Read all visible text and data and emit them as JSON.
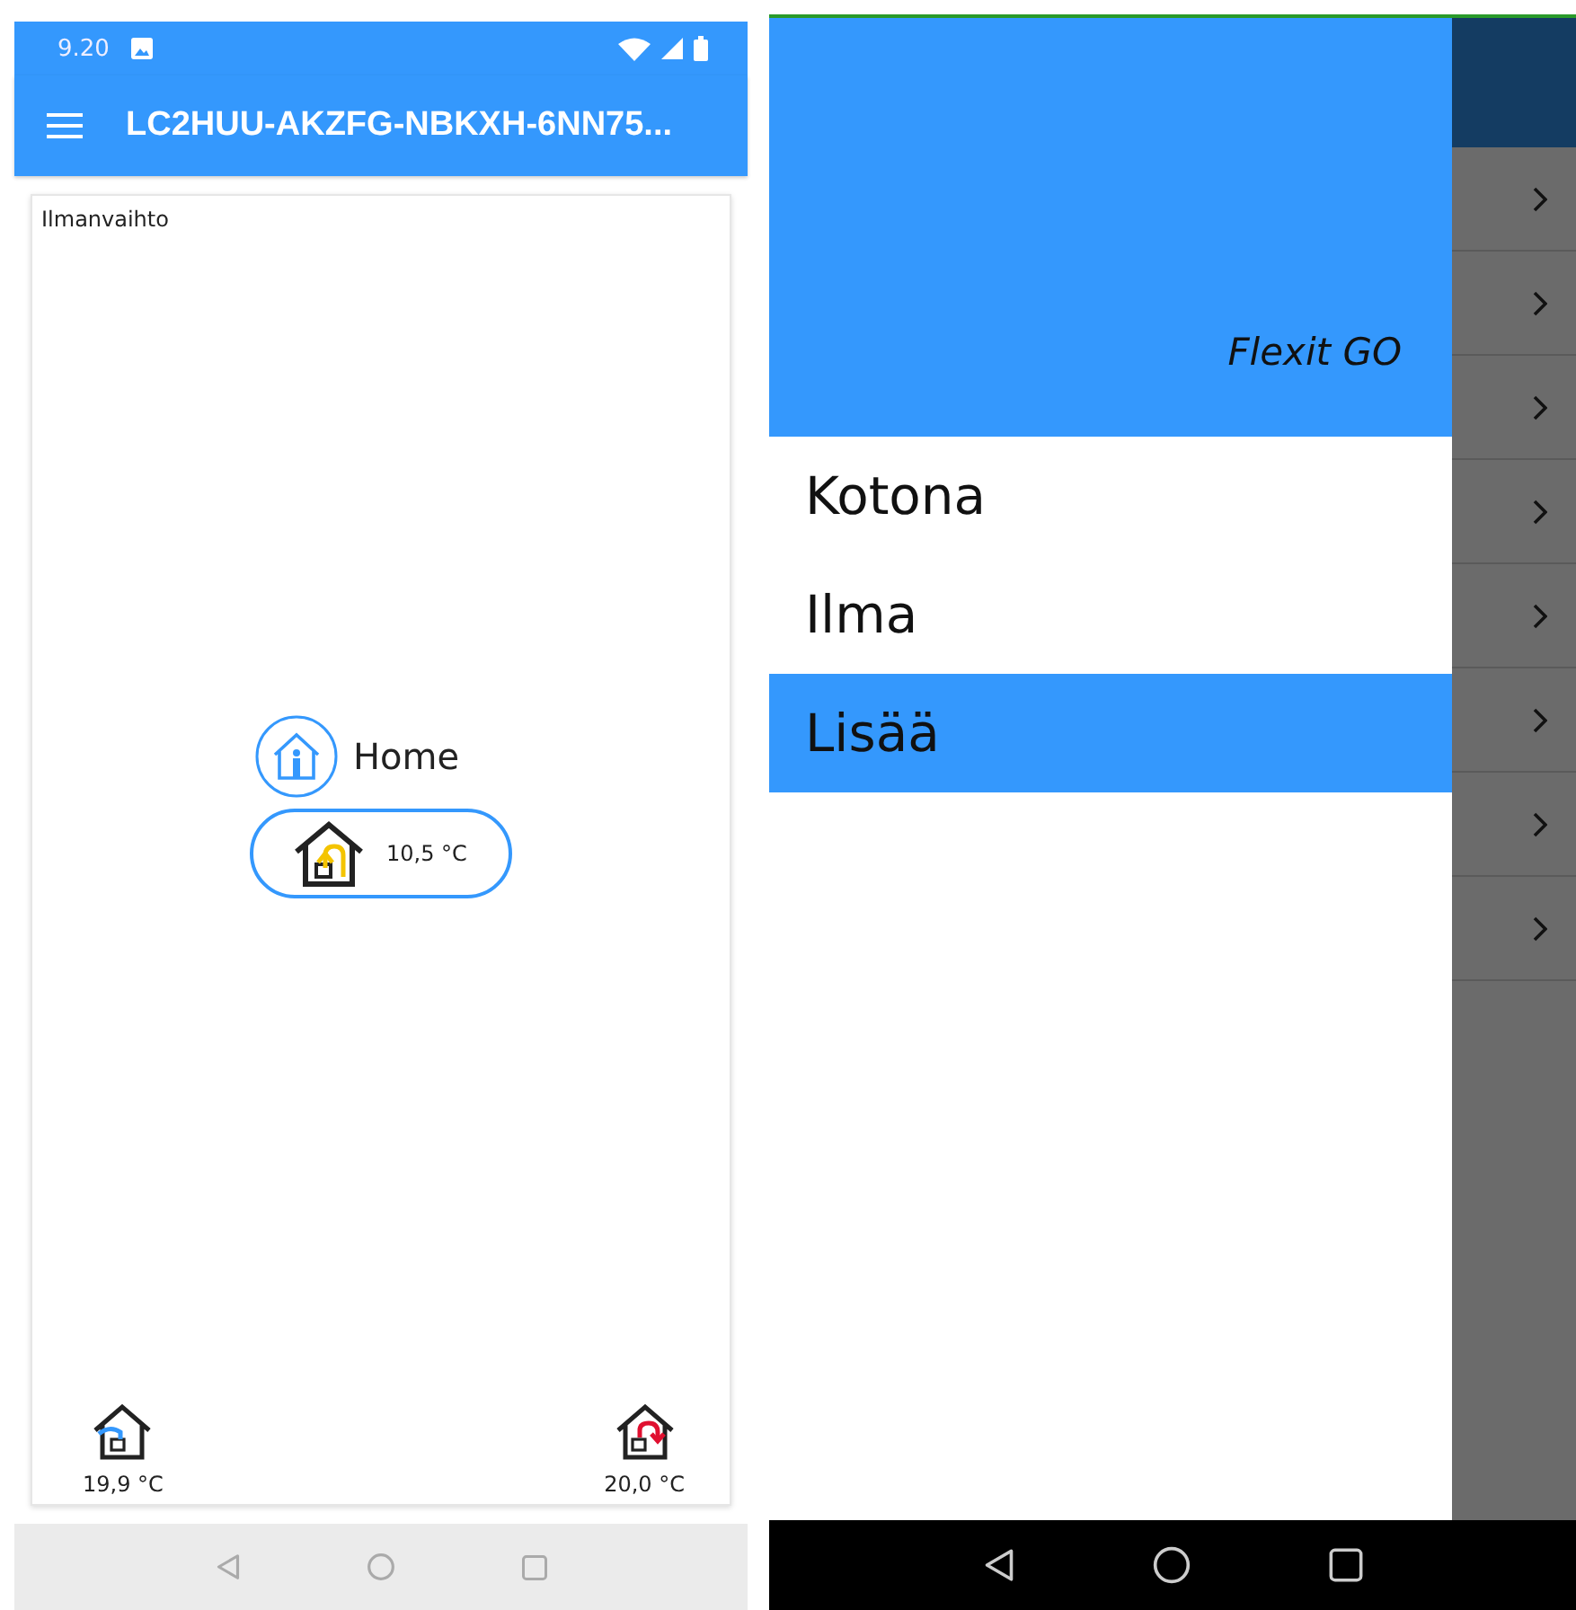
{
  "left_screen": {
    "status_bar": {
      "time": "9.20"
    },
    "app_bar": {
      "title": "LC2HUU-AKZFG-NBKXH-6NN75..."
    },
    "card": {
      "title": "Ilmanvaihto",
      "mode": "Home",
      "supply_temperature": "10,5 °C",
      "extract_temperature": "19,9 °C",
      "room_temperature": "20,0 °C"
    }
  },
  "right_screen": {
    "drawer": {
      "header": "Flexit GO",
      "items": [
        {
          "label": "Kotona",
          "selected": false
        },
        {
          "label": "Ilma",
          "selected": false
        },
        {
          "label": "Lisää",
          "selected": true
        }
      ]
    },
    "background_rows": [
      {
        "kind": "chevron"
      },
      {
        "kind": "chevron"
      },
      {
        "kind": "chevron"
      },
      {
        "kind": "chevron"
      },
      {
        "kind": "chevron"
      },
      {
        "kind": "chevron"
      },
      {
        "kind": "chevron"
      },
      {
        "kind": "chevron"
      }
    ]
  }
}
